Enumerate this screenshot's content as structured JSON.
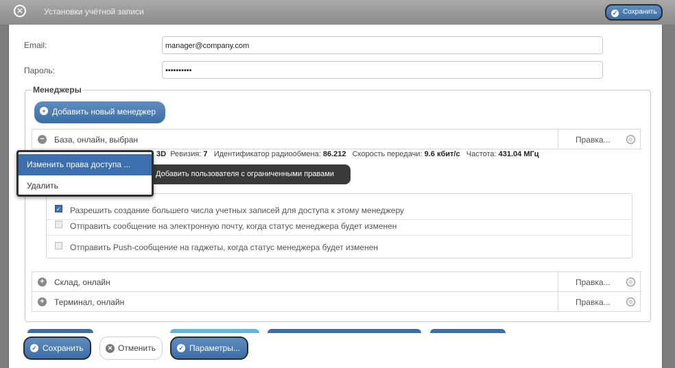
{
  "window": {
    "title": "Установки учётной записи",
    "save_label": "Сохранить"
  },
  "form": {
    "email_label": "Email:",
    "email_value": "manager@company.com",
    "password_label": "Пароль:",
    "password_value": "••••••••••"
  },
  "managers": {
    "legend": "Менеджеры",
    "add_label": "Добавить новый менеджер",
    "rows": [
      {
        "name": "База, онлайн, выбран",
        "edit": "Правка..."
      },
      {
        "name": "Склад, онлайн",
        "edit": "Правка..."
      },
      {
        "name": "Терминал, онлайн",
        "edit": "Правка..."
      }
    ],
    "details": {
      "prefix": "3D",
      "revision_label": "Ревизия:",
      "revision_value": "7",
      "radio_label": "Идентификатор радиообмена:",
      "radio_value": "86.212",
      "speed_label": "Скорость передачи:",
      "speed_value": "9.6 кбит/с",
      "freq_label": "Частота:",
      "freq_value": "431.04 МГц"
    },
    "tooltip": "Добавить пользователя с ограниченными правами",
    "permissions": [
      {
        "label": "Разрешить создание большего числа учетных записей для доступа к этому менеджеру",
        "checked": true
      },
      {
        "label": "Отправить сообщение на электронную почту, когда статус менеджера будет изменен",
        "checked": false
      },
      {
        "label": "Отправить Push-сообщение на гаджеты, когда статус менеджера будет изменен",
        "checked": false
      }
    ]
  },
  "context_menu": {
    "items": [
      "Изменить права доступа ...",
      "Удалить"
    ]
  },
  "footer": {
    "save_label": "Сохранить",
    "cancel_label": "Отменить",
    "params_label": "Параметры..."
  },
  "colors": {
    "primary": "#3a6ea7",
    "menu_selected": "#3d6fae",
    "tooltip_bg": "#3a3a3a"
  }
}
